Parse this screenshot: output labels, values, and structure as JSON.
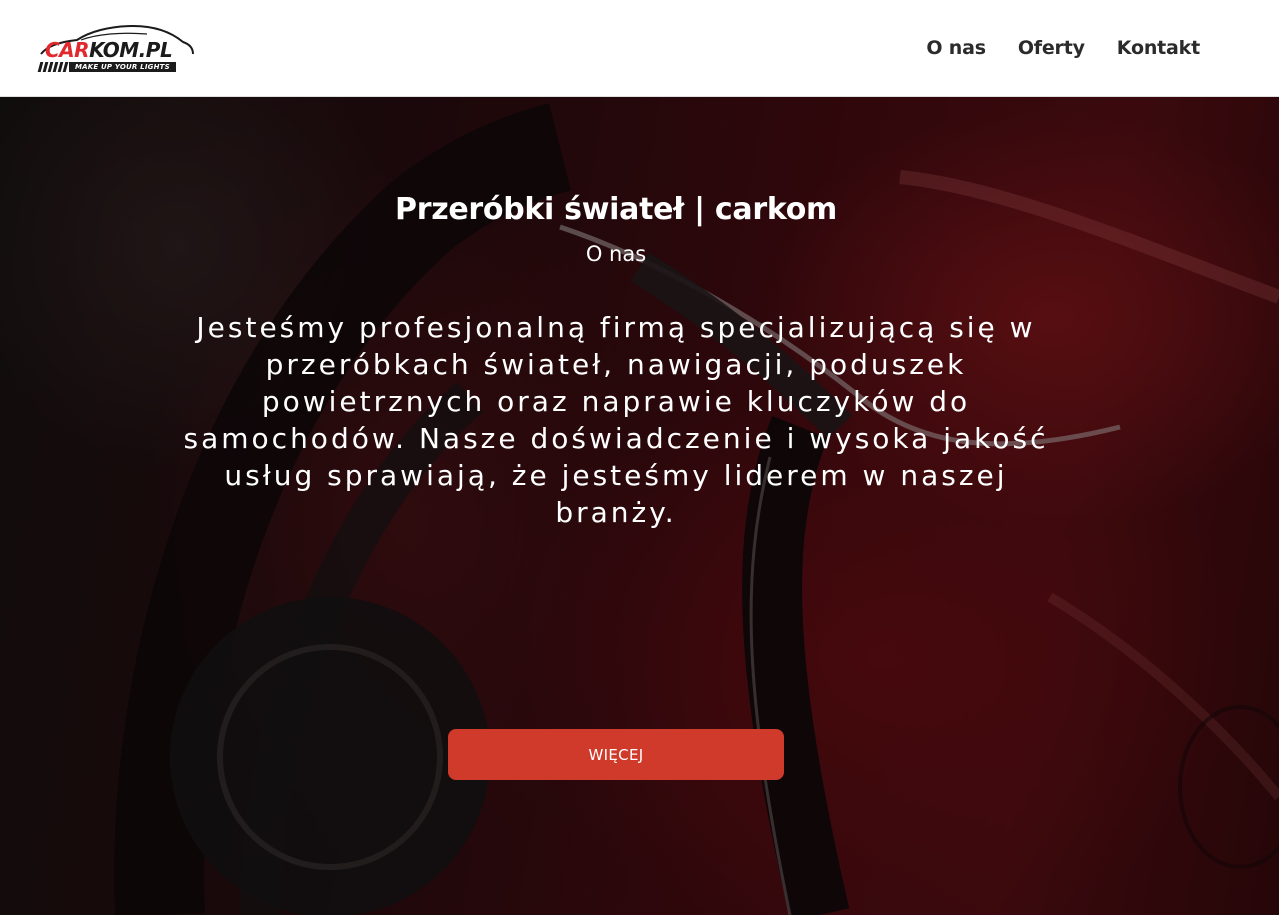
{
  "header": {
    "logo": {
      "brand_part1": "CAR",
      "brand_part2": "KOM.PL",
      "tagline": "MAKE UP YOUR LIGHTS"
    },
    "nav": [
      {
        "label": "O nas"
      },
      {
        "label": "Oferty"
      },
      {
        "label": "Kontakt"
      }
    ]
  },
  "hero": {
    "title": "Przeróbki świateł | carkom",
    "subtitle": "O nas",
    "description": "Jesteśmy profesjonalną firmą specjalizującą się w przeróbkach świateł, nawigacji, poduszek powietrznych oraz naprawie kluczyków do samochodów. Nasze doświadczenie i wysoka jakość usług sprawiają, że jesteśmy liderem w naszej branży.",
    "button_label": "WIĘCEJ"
  },
  "colors": {
    "header_bg": "#ffffff",
    "nav_text": "#2b2b2b",
    "brand_red": "#e0282e",
    "button_bg": "#cf3a2a",
    "hero_text": "#ffffff"
  }
}
